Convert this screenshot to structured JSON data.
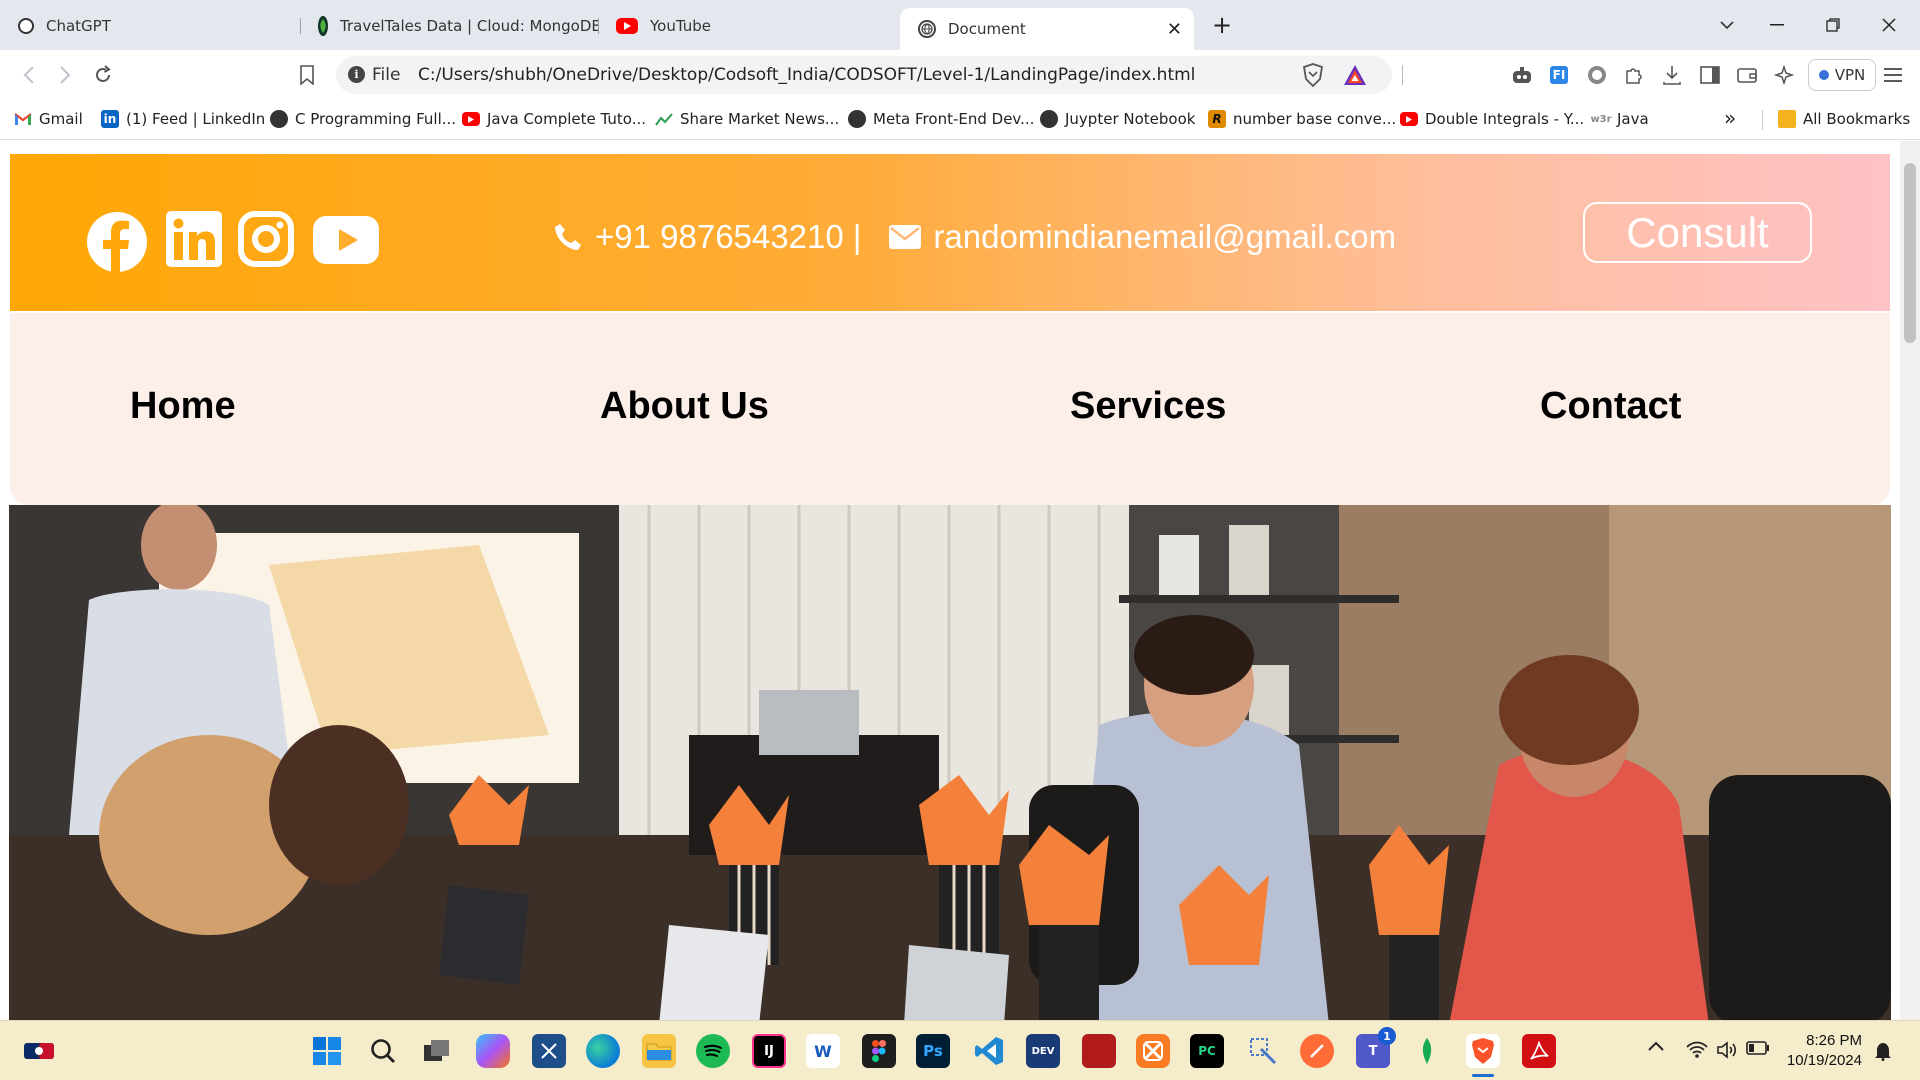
{
  "browser": {
    "tabs": [
      {
        "title": "ChatGPT",
        "icon": "openai-icon"
      },
      {
        "title": "TravelTales Data | Cloud: MongoDB",
        "icon": "mongodb-icon"
      },
      {
        "title": "YouTube",
        "icon": "youtube-icon"
      },
      {
        "title": "Document",
        "icon": "globe-icon",
        "active": true
      }
    ],
    "new_tab": "+",
    "close_tab": "✕",
    "address": {
      "scheme_label": "File",
      "url": "C:/Users/shubh/OneDrive/Desktop/Codsoft_India/CODSOFT/Level-1/LandingPage/index.html"
    },
    "vpn_label": "VPN",
    "bookmarks": [
      {
        "label": "Gmail",
        "icon": "gmail-icon"
      },
      {
        "label": "(1) Feed | LinkedIn",
        "icon": "linkedin-icon"
      },
      {
        "label": "C Programming Full...",
        "icon": "globe-icon"
      },
      {
        "label": "Java Complete Tuto...",
        "icon": "youtube-icon"
      },
      {
        "label": "Share Market News...",
        "icon": "chart-icon"
      },
      {
        "label": "Meta Front-End Dev...",
        "icon": "globe-icon"
      },
      {
        "label": "Juypter Notebook",
        "icon": "globe-icon"
      },
      {
        "label": "number base conve...",
        "icon": "r-icon"
      },
      {
        "label": "Double Integrals - Y...",
        "icon": "youtube-icon"
      },
      {
        "label": "Java",
        "icon": "w3schools-icon"
      }
    ],
    "all_bookmarks_label": "All Bookmarks",
    "more_bookmarks": "»"
  },
  "page": {
    "social_icons": [
      "facebook-icon",
      "linkedin-icon",
      "instagram-icon",
      "youtube-icon"
    ],
    "phone": "+91 9876543210 |",
    "email": "randomindianemail@gmail.com",
    "consult_label": "Consult",
    "nav": [
      "Home",
      "About Us",
      "Services",
      "Contact"
    ],
    "hero_image": "team meeting photo"
  },
  "taskbar": {
    "clock": {
      "time": "8:26 PM",
      "date": "10/19/2024"
    },
    "apps": [
      "windows-start-icon",
      "search-icon",
      "task-view-icon",
      "copilot-icon",
      "snipping-icon",
      "edge-icon",
      "file-explorer-icon",
      "spotify-icon",
      "intellij-icon",
      "word-icon",
      "figma-icon",
      "photoshop-icon",
      "vscode-icon",
      "devcpp-icon",
      "rstudio-icon",
      "xampp-icon",
      "pycharm-icon",
      "drawing-icon",
      "postman-icon",
      "teams-icon",
      "mongodb-compass-icon",
      "brave-icon",
      "acrobat-icon"
    ],
    "teams_badge": "1"
  }
}
